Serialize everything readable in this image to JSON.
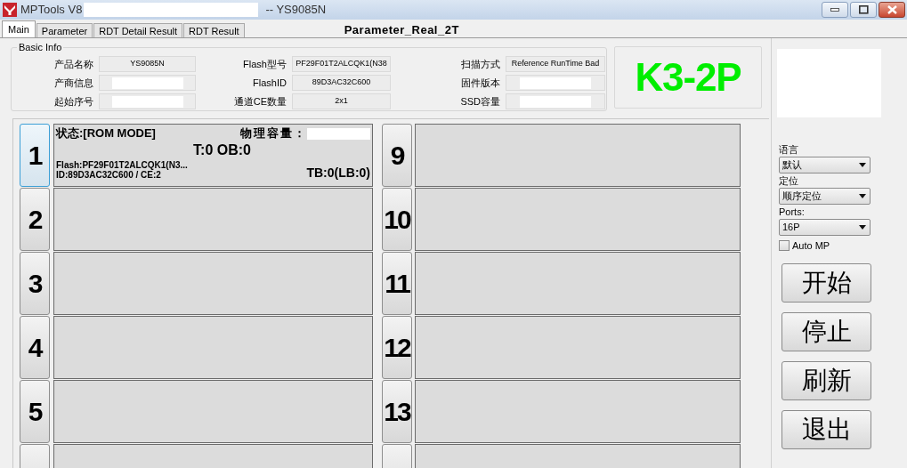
{
  "window": {
    "title": "MPTools V8",
    "subtitle": "-- YS9085N"
  },
  "tabs": [
    {
      "label": "Main",
      "selected": true
    },
    {
      "label": "Parameter",
      "selected": false
    },
    {
      "label": "RDT Detail Result",
      "selected": false
    },
    {
      "label": "RDT Result",
      "selected": false
    }
  ],
  "parameter_name": "Parameter_Real_2T",
  "basic_info": {
    "title": "Basic Info",
    "fields": [
      {
        "label": "产品名称",
        "value": "YS9085N"
      },
      {
        "label": "Flash型号",
        "value": "PF29F01T2ALCQK1(N38"
      },
      {
        "label": "扫描方式",
        "value": "Reference RunTime Bad"
      },
      {
        "label": "产商信息"
      },
      {
        "label": "FlashID",
        "value": "89D3AC32C600"
      },
      {
        "label": "固件版本"
      },
      {
        "label": "起始序号"
      },
      {
        "label": "通道CE数量",
        "value": "2x1"
      },
      {
        "label": "SSD容量"
      }
    ]
  },
  "model_badge": "K3-2P",
  "ports": [
    {
      "number": "1",
      "selected": true,
      "status": "状态:[ROM MODE]",
      "capacity_label": "物理容量：",
      "counts": "T:0 OB:0",
      "flash": "Flash:PF29F01T2ALCQK1(N3...",
      "id": "ID:89D3AC32C600 / CE:2",
      "bad_blocks": "TB:0(LB:0)"
    },
    {
      "number": "2",
      "selected": false
    },
    {
      "number": "3",
      "selected": false
    },
    {
      "number": "4",
      "selected": false
    },
    {
      "number": "5",
      "selected": false
    },
    {
      "selected": false
    },
    {
      "number": "9",
      "selected": false
    },
    {
      "number": "10",
      "selected": false
    },
    {
      "number": "11",
      "selected": false
    },
    {
      "number": "12",
      "selected": false
    },
    {
      "number": "13",
      "selected": false
    },
    {
      "selected": false
    }
  ],
  "sidebar": {
    "selects": [
      {
        "label": "语言",
        "value": "默认"
      },
      {
        "label": "定位",
        "value": "顺序定位"
      },
      {
        "label": "Ports:",
        "value": "16P"
      }
    ],
    "auto_mp": {
      "label": "Auto MP",
      "checked": false
    },
    "buttons": [
      "开始",
      "停止",
      "刷新",
      "退出"
    ]
  }
}
